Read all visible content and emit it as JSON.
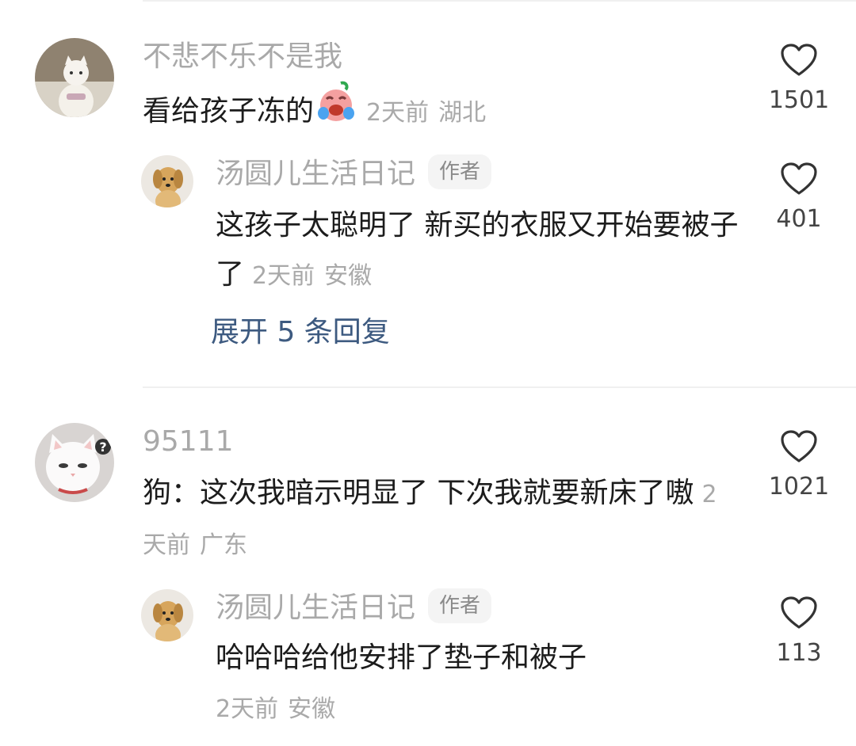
{
  "comments": [
    {
      "username": "不悲不乐不是我",
      "text": "看给孩子冻的",
      "emoji": "crying-laughing-emoji",
      "time": "2天前",
      "region": "湖北",
      "likes": "1501",
      "replies": [
        {
          "username": "汤圆儿生活日记",
          "badge": "作者",
          "text": "这孩子太聪明了 新买的衣服又开始要被子了",
          "time": "2天前",
          "region": "安徽",
          "likes": "401"
        }
      ],
      "expand_label": "展开 5 条回复"
    },
    {
      "username": "95111",
      "text": "狗：这次我暗示明显了 下次我就要新床了嗷",
      "time": "2天前",
      "region": "广东",
      "likes": "1021",
      "replies": [
        {
          "username": "汤圆儿生活日记",
          "badge": "作者",
          "text": "哈哈哈给他安排了垫子和被子",
          "time": "2天前",
          "region": "安徽",
          "likes": "113"
        }
      ]
    }
  ],
  "colors": {
    "username": "#a9a9a9",
    "text": "#1c1c1c",
    "link": "#3d5a80",
    "badge_bg": "#f4f4f4"
  }
}
